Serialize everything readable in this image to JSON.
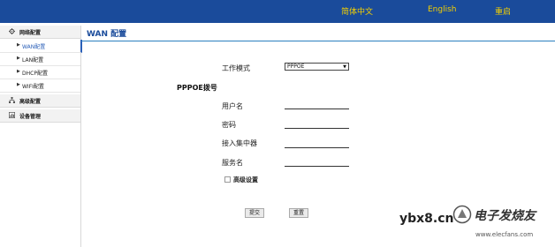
{
  "header": {
    "lang_zh": "简体中文",
    "lang_en": "English",
    "restart": "重启",
    "accent_color": "#f5d000",
    "bg_color": "#1a4b9b"
  },
  "sidebar": {
    "groups": [
      {
        "label": "网络配置",
        "icon": "gear-icon"
      },
      {
        "label": "高级配置",
        "icon": "network-tree-icon"
      },
      {
        "label": "设备管理",
        "icon": "bar-chart-icon"
      }
    ],
    "subitems": [
      {
        "label": "WAN配置",
        "active": true
      },
      {
        "label": "LAN配置",
        "active": false
      },
      {
        "label": "DHCP配置",
        "active": false
      },
      {
        "label": "WIFI配置",
        "active": false
      }
    ]
  },
  "main": {
    "title": "WAN 配置",
    "mode_label": "工作模式",
    "mode_value": "PPPOE",
    "section_title": "PPPOE拨号",
    "fields": {
      "username_label": "用户名",
      "password_label": "密码",
      "concentrator_label": "接入集中器",
      "service_label": "服务名"
    },
    "advanced_label": "高级设置",
    "submit_label": "提交",
    "reset_label": "重置"
  },
  "watermark": {
    "site": "ybx8.cn",
    "brand": "电子发烧友",
    "url": "www.elecfans.com"
  }
}
